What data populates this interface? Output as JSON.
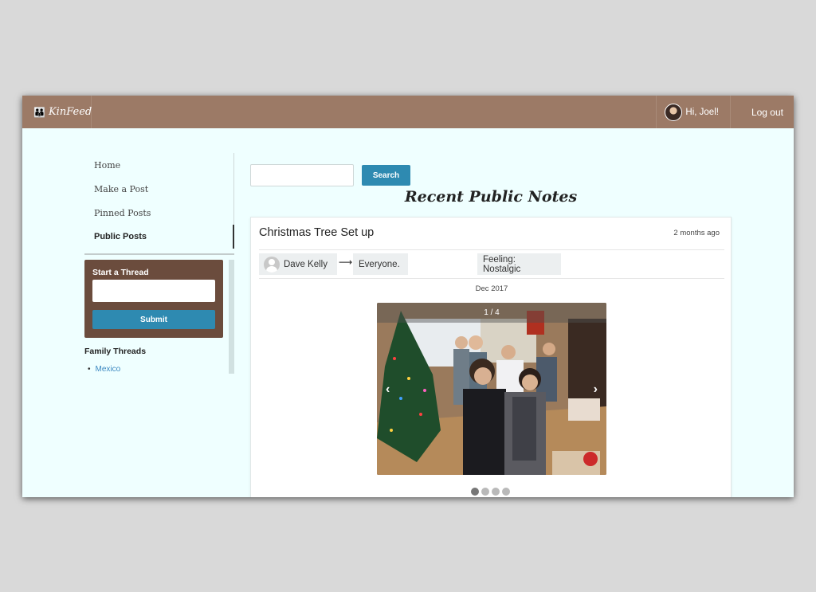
{
  "navbar": {
    "brand": "KinFeed",
    "greeting": "Hi, Joel!",
    "logout": "Log out",
    "accent": "#9c7a66"
  },
  "sidebar": {
    "items": [
      {
        "label": "Home"
      },
      {
        "label": "Make a Post"
      },
      {
        "label": "Pinned Posts"
      },
      {
        "label": "Public Posts",
        "active": true
      }
    ],
    "thread": {
      "title": "Start a Thread",
      "submit": "Submit",
      "color": "#6b4c3d"
    },
    "family_threads": {
      "title": "Family Threads",
      "items": [
        "Mexico"
      ]
    }
  },
  "search": {
    "button": "Search",
    "button_color": "#2e8ab1"
  },
  "main": {
    "title": "Recent Public Notes",
    "post": {
      "title": "Christmas Tree Set up",
      "time": "2 months ago",
      "author": "Dave Kelly",
      "audience": "Everyone.",
      "feeling": "Feeling: Nostalgic",
      "date": "Dec 2017",
      "carousel": {
        "counter": "1 / 4",
        "current": 1,
        "total": 4
      }
    }
  },
  "icons": {
    "brand": "users-icon",
    "arrow": "arrow-right-icon",
    "prev": "chevron-left-icon",
    "next": "chevron-right-icon"
  }
}
